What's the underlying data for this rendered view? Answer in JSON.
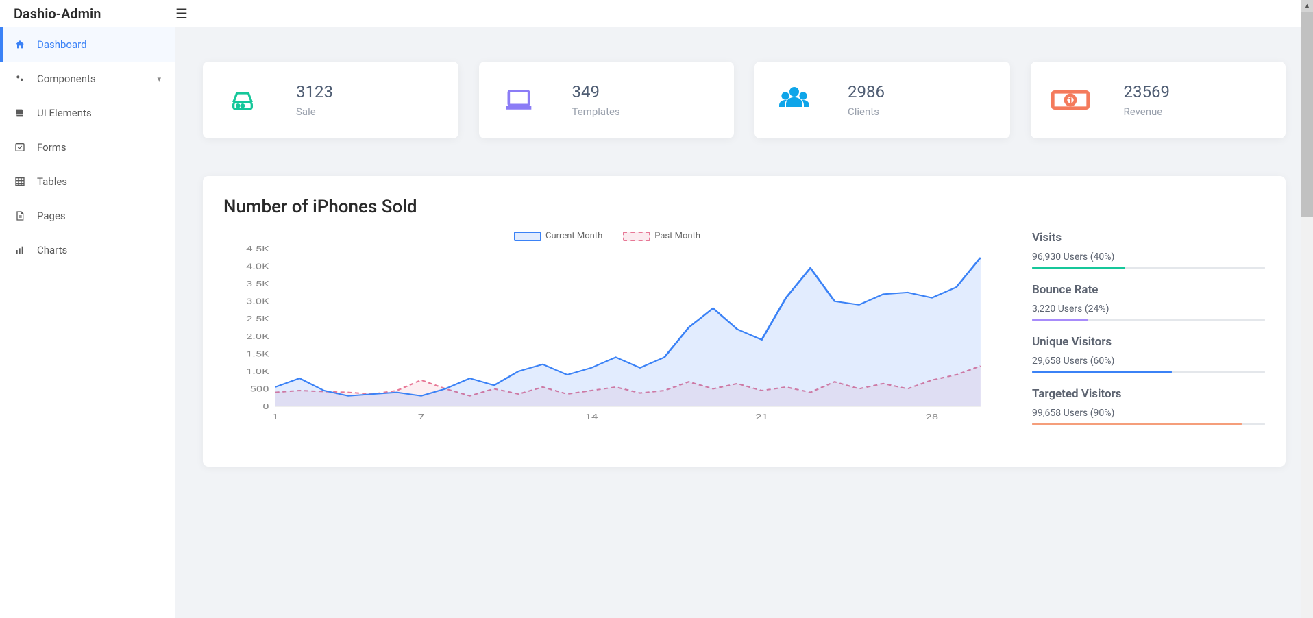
{
  "brand": "Dashio-Admin",
  "sidebar": {
    "items": [
      {
        "label": "Dashboard",
        "icon": "home-icon",
        "active": true
      },
      {
        "label": "Components",
        "icon": "cogs-icon",
        "expandable": true
      },
      {
        "label": "UI Elements",
        "icon": "book-icon"
      },
      {
        "label": "Forms",
        "icon": "check-icon"
      },
      {
        "label": "Tables",
        "icon": "table-icon"
      },
      {
        "label": "Pages",
        "icon": "page-icon"
      },
      {
        "label": "Charts",
        "icon": "bar-chart-icon"
      }
    ]
  },
  "stats": [
    {
      "value": "3123",
      "label": "Sale",
      "icon": "drive-icon",
      "color": "#16c79a"
    },
    {
      "value": "349",
      "label": "Templates",
      "icon": "laptop-icon",
      "color": "#8b7cf6"
    },
    {
      "value": "2986",
      "label": "Clients",
      "icon": "users-icon",
      "color": "#0ea5e9"
    },
    {
      "value": "23569",
      "label": "Revenue",
      "icon": "money-icon",
      "color": "#f47b5c"
    }
  ],
  "chart_card": {
    "title": "Number of iPhones Sold",
    "legend": {
      "current": "Current Month",
      "past": "Past Month"
    }
  },
  "metrics": [
    {
      "title": "Visits",
      "text": "96,930 Users (40%)",
      "pct": 40,
      "color": "green"
    },
    {
      "title": "Bounce Rate",
      "text": "3,220 Users (24%)",
      "pct": 24,
      "color": "purple"
    },
    {
      "title": "Unique Visitors",
      "text": "29,658 Users (60%)",
      "pct": 60,
      "color": "blue"
    },
    {
      "title": "Targeted Visitors",
      "text": "99,658 Users (90%)",
      "pct": 90,
      "color": "orange"
    }
  ],
  "chart_data": {
    "type": "line",
    "title": "Number of iPhones Sold",
    "xlabel": "",
    "ylabel": "",
    "x_ticks": [
      1,
      7,
      14,
      21,
      28
    ],
    "y_ticks": [
      0,
      500,
      1000,
      1500,
      2000,
      2500,
      3000,
      3500,
      4000,
      4500
    ],
    "y_tick_labels": [
      "0",
      "500",
      "1.0K",
      "1.5K",
      "2.0K",
      "2.5K",
      "3.0K",
      "3.5K",
      "4.0K",
      "4.5K"
    ],
    "ylim": [
      0,
      4500
    ],
    "xlim": [
      1,
      30
    ],
    "x": [
      1,
      2,
      3,
      4,
      5,
      6,
      7,
      8,
      9,
      10,
      11,
      12,
      13,
      14,
      15,
      16,
      17,
      18,
      19,
      20,
      21,
      22,
      23,
      24,
      25,
      26,
      27,
      28,
      29,
      30
    ],
    "series": [
      {
        "name": "Current Month",
        "color": "#3b82f6",
        "dashed": false,
        "fill": "rgba(59,130,246,0.15)",
        "values": [
          550,
          800,
          450,
          300,
          350,
          400,
          300,
          500,
          800,
          600,
          1000,
          1200,
          900,
          1100,
          1400,
          1100,
          1400,
          2250,
          2800,
          2200,
          1900,
          3100,
          3950,
          3000,
          2900,
          3200,
          3250,
          3100,
          3400,
          4250
        ]
      },
      {
        "name": "Past Month",
        "color": "#e77896",
        "dashed": true,
        "fill": "rgba(231,120,150,0.12)",
        "values": [
          400,
          450,
          420,
          400,
          350,
          450,
          750,
          500,
          300,
          500,
          350,
          550,
          350,
          450,
          550,
          380,
          450,
          700,
          500,
          650,
          450,
          550,
          400,
          700,
          500,
          650,
          500,
          750,
          900,
          1150
        ]
      }
    ]
  }
}
